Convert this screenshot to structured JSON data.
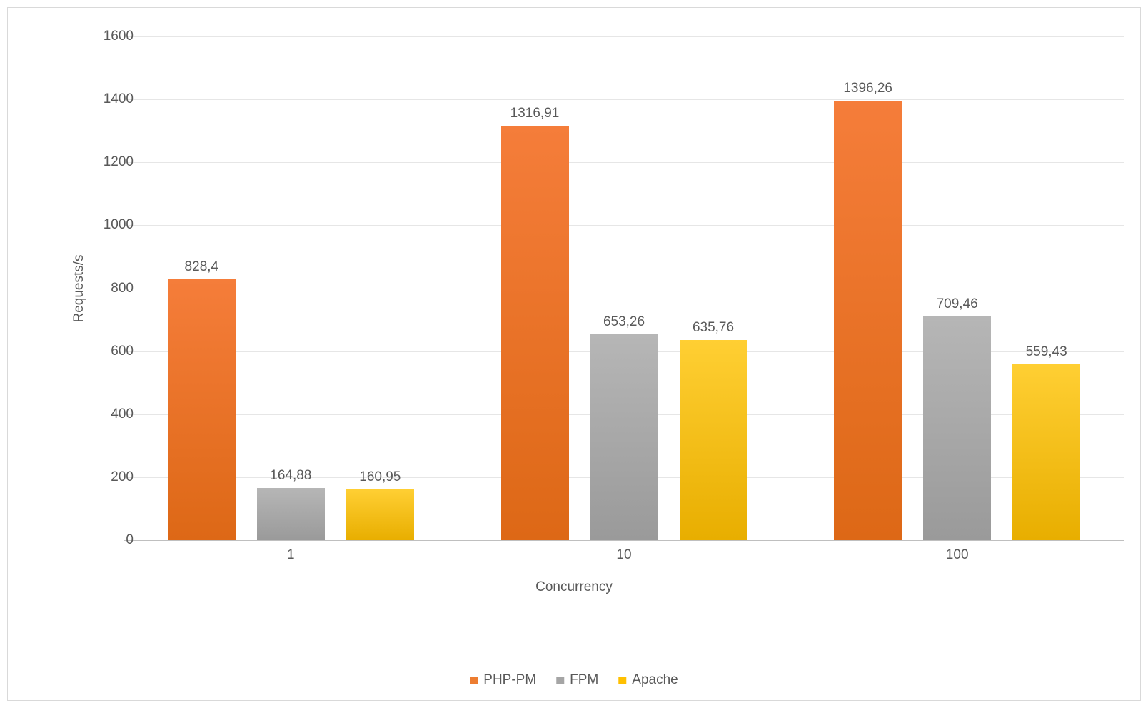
{
  "chart_data": {
    "type": "bar",
    "title": "",
    "xlabel": "Concurrency",
    "ylabel": "Requests/s",
    "categories": [
      "1",
      "10",
      "100"
    ],
    "ylim": [
      0,
      1600
    ],
    "ytick_step": 200,
    "colors": {
      "PHP-PM": "#ed7d31",
      "FPM": "#a5a5a5",
      "Apache": "#ffc000"
    },
    "legend_position": "bottom",
    "series": [
      {
        "name": "PHP-PM",
        "values": [
          828.4,
          1316.91,
          1396.26
        ],
        "labels": [
          "828,4",
          "1316,91",
          "1396,26"
        ]
      },
      {
        "name": "FPM",
        "values": [
          164.88,
          653.26,
          709.46
        ],
        "labels": [
          "164,88",
          "653,26",
          "709,46"
        ]
      },
      {
        "name": "Apache",
        "values": [
          160.95,
          635.76,
          559.43
        ],
        "labels": [
          "160,95",
          "635,76",
          "559,43"
        ]
      }
    ]
  }
}
